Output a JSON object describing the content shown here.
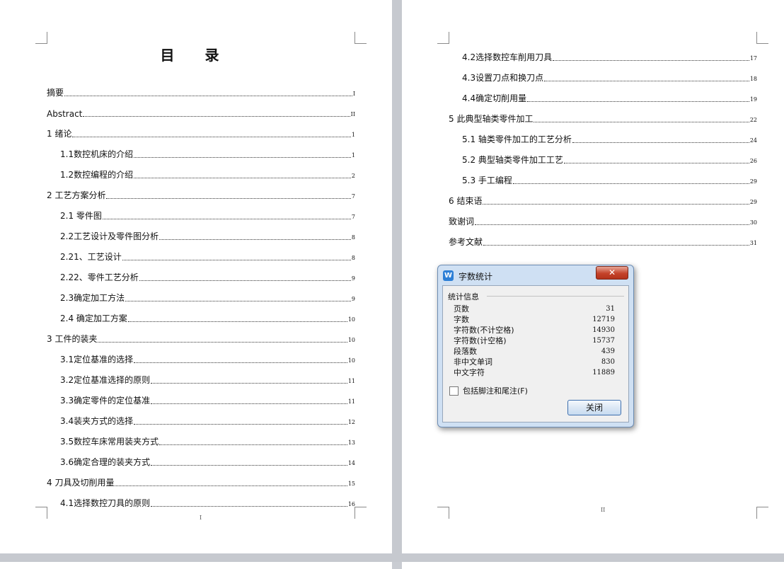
{
  "left_page": {
    "title": "目 录",
    "footer_page_number": "I",
    "toc": [
      {
        "text": "摘要",
        "page": "I",
        "level": 1
      },
      {
        "text": "Abstract",
        "page": "II",
        "level": 1
      },
      {
        "text": "1  绪论",
        "page": "1",
        "level": 1
      },
      {
        "text": "1.1数控机床的介绍",
        "page": "1",
        "level": 2
      },
      {
        "text": "1.2数控编程的介绍",
        "page": "2",
        "level": 2
      },
      {
        "text": "2  工艺方案分析",
        "page": "7",
        "level": 1
      },
      {
        "text": "2.1  零件图",
        "page": "7",
        "level": 2
      },
      {
        "text": "2.2工艺设计及零件图分析",
        "page": "8",
        "level": 2
      },
      {
        "text": "2.21、工艺设计",
        "page": "8",
        "level": 2
      },
      {
        "text": "2.22、零件工艺分析",
        "page": "9",
        "level": 2
      },
      {
        "text": "2.3确定加工方法",
        "page": "9",
        "level": 2
      },
      {
        "text": "2.4  确定加工方案",
        "page": "10",
        "level": 2
      },
      {
        "text": "3  工件的装夹",
        "page": "10",
        "level": 1
      },
      {
        "text": "3.1定位基准的选择",
        "page": "10",
        "level": 2
      },
      {
        "text": "3.2定位基准选择的原则",
        "page": "11",
        "level": 2
      },
      {
        "text": "3.3确定零件的定位基准",
        "page": "11",
        "level": 2
      },
      {
        "text": "3.4装夹方式的选择",
        "page": "12",
        "level": 2
      },
      {
        "text": "3.5数控车床常用装夹方式",
        "page": "13",
        "level": 2
      },
      {
        "text": "3.6确定合理的装夹方式",
        "page": "14",
        "level": 2
      },
      {
        "text": "4  刀具及切削用量",
        "page": "15",
        "level": 1
      },
      {
        "text": "4.1选择数控刀具的原则",
        "page": "16",
        "level": 2
      }
    ]
  },
  "right_page": {
    "footer_page_number": "II",
    "toc": [
      {
        "text": "4.2选择数控车削用刀具",
        "page": "17",
        "level": 2
      },
      {
        "text": "4.3设置刀点和换刀点",
        "page": "18",
        "level": 2
      },
      {
        "text": "4.4确定切削用量",
        "page": "19",
        "level": 2
      },
      {
        "text": "5 此典型轴类零件加工",
        "page": "22",
        "level": 1
      },
      {
        "text": "5.1 轴类零件加工的工艺分析",
        "page": "24",
        "level": 2
      },
      {
        "text": "5.2 典型轴类零件加工工艺",
        "page": "26",
        "level": 2
      },
      {
        "text": "5.3 手工编程",
        "page": "29",
        "level": 2
      },
      {
        "text": "6 结束语",
        "page": "29",
        "level": 1
      },
      {
        "text": "致谢词",
        "page": "30",
        "level": 1
      },
      {
        "text": "参考文献",
        "page": "31",
        "level": 1
      }
    ]
  },
  "dialog": {
    "title": "字数统计",
    "app_icon_glyph": "W",
    "close_glyph": "✕",
    "group_label": "统计信息",
    "stats": [
      {
        "label": "页数",
        "value": "31"
      },
      {
        "label": "字数",
        "value": "12719"
      },
      {
        "label": "字符数(不计空格)",
        "value": "14930"
      },
      {
        "label": "字符数(计空格)",
        "value": "15737"
      },
      {
        "label": "段落数",
        "value": "439"
      },
      {
        "label": "非中文单词",
        "value": "830"
      },
      {
        "label": "中文字符",
        "value": "11889"
      }
    ],
    "checkbox_label": "包括脚注和尾注(F)",
    "checkbox_checked": false,
    "close_button": "关闭"
  },
  "colors": {
    "workspace": "#c9ccd2",
    "dialog_frame": "#cfe0f3",
    "close_red": "#c4432a"
  }
}
